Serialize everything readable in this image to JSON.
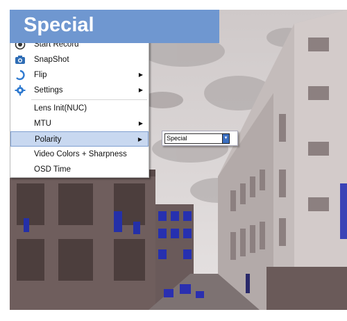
{
  "title": "Special",
  "menu": {
    "items": [
      {
        "label": "Start Record",
        "icon": "record-icon"
      },
      {
        "label": "SnapShot",
        "icon": "camera-icon"
      },
      {
        "label": "Flip",
        "icon": "rotate-icon",
        "has_submenu": true
      },
      {
        "label": "Settings",
        "icon": "gear-icon",
        "has_submenu": true
      },
      {
        "label": "Lens Init(NUC)"
      },
      {
        "label": "MTU",
        "has_submenu": true
      },
      {
        "label": "Polarity",
        "has_submenu": true,
        "highlighted": true
      },
      {
        "label": "Video Colors + Sharpness"
      },
      {
        "label": "OSD Time"
      }
    ]
  },
  "submenu": {
    "polarity_value": "Special"
  },
  "colors": {
    "banner": "#6f97d0",
    "highlight": "#c8d8f0"
  }
}
